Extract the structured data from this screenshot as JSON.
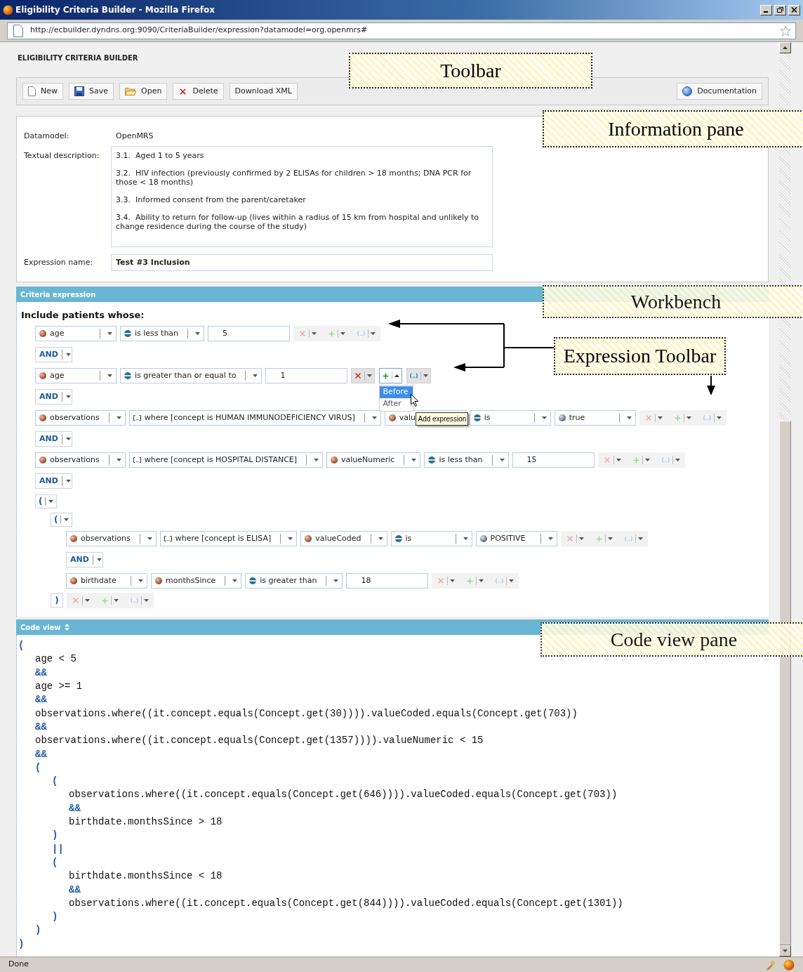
{
  "window": {
    "title": "Eligibility Criteria Builder - Mozilla Firefox",
    "url": "http://ecbuilder.dyndns.org:9090/CriteriaBuilder/expression?datamodel=org.openmrs#"
  },
  "app_title": "ELIGIBILITY CRITERIA BUILDER",
  "toolbar": {
    "buttons": [
      {
        "label": "New"
      },
      {
        "label": "Save"
      },
      {
        "label": "Open"
      },
      {
        "label": "Delete"
      },
      {
        "label": "Download XML"
      }
    ],
    "right_button": {
      "label": "Documentation"
    }
  },
  "info": {
    "datamodel": {
      "label": "Datamodel:",
      "value": "OpenMRS"
    },
    "description": {
      "label": "Textual description:",
      "paragraphs": [
        "3.1.  Aged 1 to 5 years",
        "3.2.  HIV infection (previously confirmed by 2 ELISAs for children > 18 months; DNA PCR for those < 18 months)",
        "3.3.  Informed consent from the parent/caretaker",
        "3.4.  Ability to return for follow-up (lives within a radius of 15 km from hospital and unlikely to change residence during the course of the study)"
      ]
    },
    "expression_name": {
      "label": "Expression name:",
      "value": "Test #3 Inclusion"
    }
  },
  "criteria": {
    "title": "Criteria expression",
    "heading": "Include patients whose:",
    "rows": [
      {
        "kind": "condition",
        "fields": [
          {
            "kind": "attribute",
            "text": "age"
          },
          {
            "kind": "operator",
            "text": "is less than"
          },
          {
            "kind": "input",
            "text": "5"
          }
        ],
        "toolbar": {
          "active": false
        }
      },
      {
        "kind": "operator",
        "label": "AND"
      },
      {
        "kind": "condition",
        "fields": [
          {
            "kind": "attribute",
            "text": "age"
          },
          {
            "kind": "operator",
            "text": "is greater than or equal to"
          },
          {
            "kind": "input",
            "text": "1"
          }
        ],
        "toolbar": {
          "active": true,
          "menu": {
            "items": [
              {
                "label": "Before",
                "selected": true
              },
              {
                "label": "After",
                "selected": false
              }
            ],
            "tooltip": "Add expression"
          }
        }
      },
      {
        "kind": "operator",
        "label": "AND"
      },
      {
        "kind": "condition",
        "fields": [
          {
            "kind": "attribute",
            "text": "observations"
          },
          {
            "kind": "filter",
            "text": "where [concept is HUMAN IMMUNODEFICIENCY VIRUS]"
          },
          {
            "kind": "attribute",
            "text": "valu"
          },
          {
            "kind": "operator",
            "text": "is"
          },
          {
            "kind": "value",
            "text": "true"
          }
        ],
        "toolbar": {
          "active": false
        }
      },
      {
        "kind": "operator",
        "label": "AND"
      },
      {
        "kind": "condition",
        "fields": [
          {
            "kind": "attribute",
            "text": "observations"
          },
          {
            "kind": "filter",
            "text": "where [concept is HOSPITAL DISTANCE]"
          },
          {
            "kind": "attribute",
            "text": "valueNumeric"
          },
          {
            "kind": "operator",
            "text": "is less than"
          },
          {
            "kind": "input",
            "text": "15"
          }
        ],
        "toolbar": {
          "active": false
        }
      },
      {
        "kind": "operator",
        "label": "AND"
      },
      {
        "kind": "group",
        "open": "(",
        "children": [
          {
            "kind": "group",
            "open": "(",
            "close": ")",
            "children": [
              {
                "kind": "condition",
                "fields": [
                  {
                    "kind": "attribute",
                    "text": "observations"
                  },
                  {
                    "kind": "filter",
                    "text": "where [concept is ELISA]"
                  },
                  {
                    "kind": "attribute",
                    "text": "valueCoded"
                  },
                  {
                    "kind": "operator",
                    "text": "is"
                  },
                  {
                    "kind": "value",
                    "text": "POSITIVE"
                  }
                ],
                "toolbar": {
                  "active": false
                }
              },
              {
                "kind": "operator",
                "label": "AND"
              },
              {
                "kind": "condition",
                "fields": [
                  {
                    "kind": "attribute",
                    "text": "birthdate"
                  },
                  {
                    "kind": "attribute",
                    "text": "monthsSince"
                  },
                  {
                    "kind": "operator",
                    "text": "is greater than"
                  },
                  {
                    "kind": "input",
                    "text": "18"
                  }
                ],
                "toolbar": {
                  "active": false
                }
              }
            ]
          }
        ]
      }
    ]
  },
  "code_view": {
    "title": "Code view",
    "lines": [
      {
        "kind": "symbol",
        "text": "("
      },
      {
        "children": [
          {
            "kind": "statement",
            "text": "age < 5"
          },
          {
            "kind": "symbol",
            "text": "&&"
          },
          {
            "kind": "statement",
            "text": "age >= 1"
          },
          {
            "kind": "symbol",
            "text": "&&"
          },
          {
            "kind": "statement",
            "text": "observations.where((it.concept.equals(Concept.get(30)))).valueCoded.equals(Concept.get(703))"
          },
          {
            "kind": "symbol",
            "text": "&&"
          },
          {
            "kind": "statement",
            "text": "observations.where((it.concept.equals(Concept.get(1357)))).valueNumeric < 15"
          },
          {
            "kind": "symbol",
            "text": "&&"
          },
          {
            "kind": "symbol",
            "text": "("
          },
          {
            "children": [
              {
                "kind": "symbol",
                "text": "("
              },
              {
                "children": [
                  {
                    "kind": "statement",
                    "text": "observations.where((it.concept.equals(Concept.get(646)))).valueCoded.equals(Concept.get(703))"
                  },
                  {
                    "kind": "symbol",
                    "text": "&&"
                  },
                  {
                    "kind": "statement",
                    "text": "birthdate.monthsSince > 18"
                  }
                ]
              },
              {
                "kind": "symbol",
                "text": ")"
              },
              {
                "kind": "symbol",
                "text": "||"
              },
              {
                "kind": "symbol",
                "text": "("
              },
              {
                "children": [
                  {
                    "kind": "statement",
                    "text": "birthdate.monthsSince < 18"
                  },
                  {
                    "kind": "symbol",
                    "text": "&&"
                  },
                  {
                    "kind": "statement",
                    "text": "observations.where((it.concept.equals(Concept.get(844)))).valueCoded.equals(Concept.get(1301))"
                  }
                ]
              },
              {
                "kind": "symbol",
                "text": ")"
              }
            ]
          },
          {
            "kind": "symbol",
            "text": ")"
          }
        ]
      },
      {
        "kind": "symbol",
        "text": ")"
      }
    ]
  },
  "callouts": [
    {
      "label": "Toolbar"
    },
    {
      "label": "Information pane"
    },
    {
      "label": "Workbench"
    },
    {
      "label": "Expression Toolbar"
    },
    {
      "label": "Code view pane"
    }
  ],
  "status_bar": {
    "text": "Done"
  }
}
